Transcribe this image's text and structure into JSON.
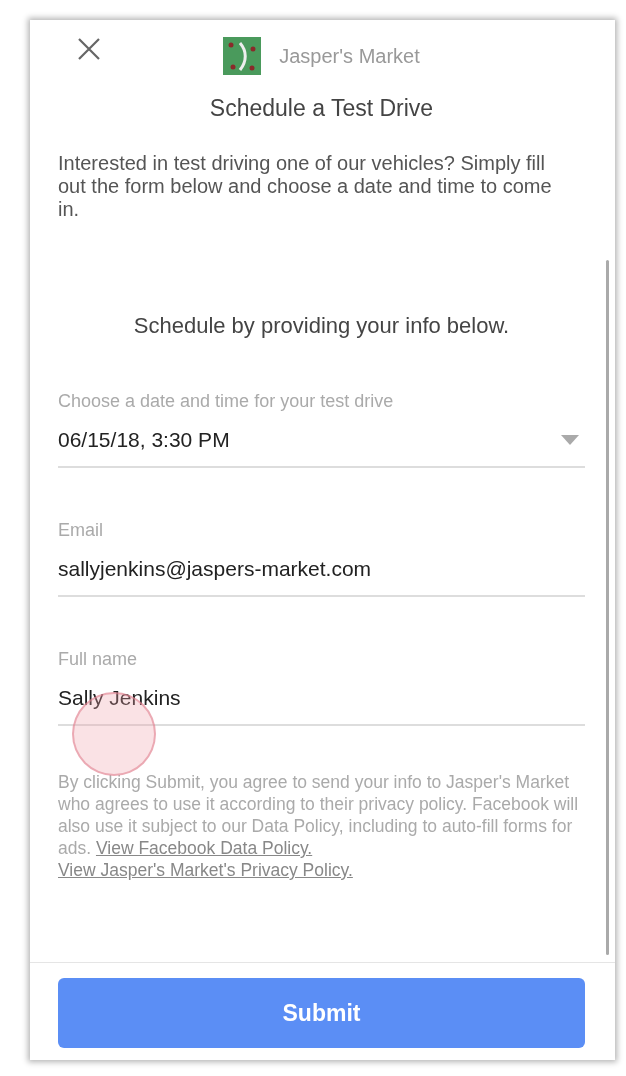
{
  "header": {
    "page_name": "Jasper's Market",
    "title": "Schedule a Test Drive"
  },
  "intro": "Interested in test driving one of our vehicles? Simply fill out the form below and choose a date and time to come in.",
  "section_heading": "Schedule by providing your info below.",
  "fields": [
    {
      "kind": "dropdown",
      "label": "Choose a date and time for your test drive",
      "value": "06/15/18, 3:30 PM"
    },
    {
      "kind": "text",
      "label": "Email",
      "value": "sallyjenkins@jaspers-market.com"
    },
    {
      "kind": "text",
      "label": "Full name",
      "value": "Sally Jenkins"
    }
  ],
  "disclaimer": {
    "text": "By clicking Submit, you agree to send your info to Jasper's Market who agrees to use it according to their privacy policy. Facebook will also use it subject to our Data Policy, including to auto-fill forms for ads.",
    "links": [
      "View Facebook Data Policy.",
      "View Jasper's Market's Privacy Policy."
    ]
  },
  "submit": "Submit"
}
